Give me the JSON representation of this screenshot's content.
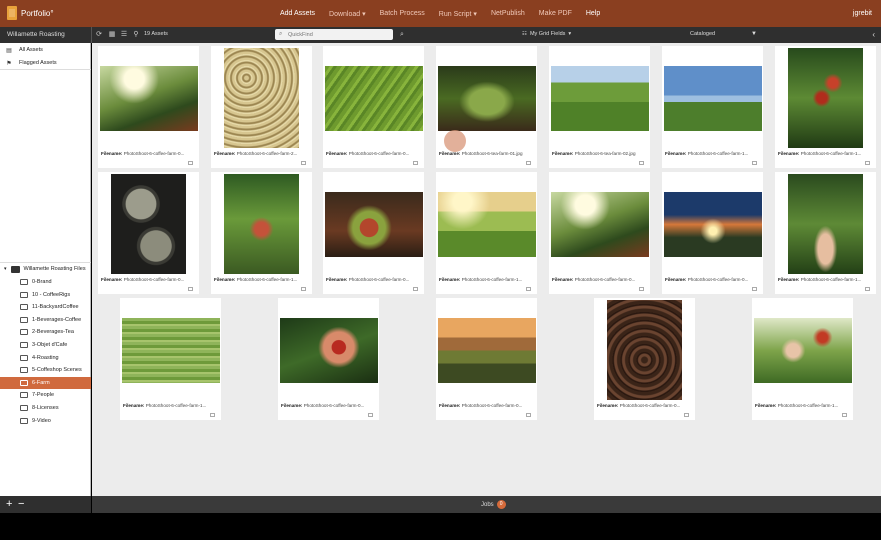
{
  "app": {
    "logo_text": "Portfolio°",
    "nav": [
      "Add Assets",
      "Download",
      "Batch Process",
      "Run Script",
      "NetPublish",
      "Make PDF",
      "Help"
    ],
    "nav_dropdowns": [
      false,
      true,
      false,
      true,
      false,
      false,
      false
    ],
    "user": "jgrebit"
  },
  "toolbar": {
    "library_title": "Willamette Roasting",
    "asset_count": "19 Assets",
    "quickfind_placeholder": "QuickFind",
    "grid_fields": "My Grid Fields",
    "catalog_status": "Cataloged"
  },
  "sidebar": {
    "top_items": [
      {
        "label": "All Assets",
        "icon": "stack-icon"
      },
      {
        "label": "Flagged Assets",
        "icon": "flag-icon"
      }
    ],
    "tree_root": "Willamette Roasting Files",
    "folders": [
      "0-Brand",
      "10 - CoffeeRigs",
      "11-BackyardCoffee",
      "1-Beverages-Coffee",
      "2-Beverages-Tea",
      "3-Objet d'Cafe",
      "4-Roasting",
      "5-Coffeshop Scenes",
      "6-Farm",
      "7-People",
      "8-Licenses",
      "9-Video"
    ],
    "selected_folder": "6-Farm"
  },
  "footer": {
    "jobs_label": "Jobs",
    "jobs_count": "0"
  },
  "grid": {
    "filename_label": "Filename:",
    "assets": [
      {
        "filename": "PhotoShoot-6-coffee-farm-0...",
        "img": "coffeesun",
        "orientation": "landscape"
      },
      {
        "filename": "PhotoShoot-6-coffee-farm-2...",
        "img": "beans",
        "orientation": "portrait"
      },
      {
        "filename": "PhotoShoot-6-coffee-farm-0...",
        "img": "terrace",
        "orientation": "landscape"
      },
      {
        "filename": "PhotoShoot-6-tea-farm-01.jpg",
        "img": "tealeaf",
        "orientation": "landscape"
      },
      {
        "filename": "PhotoShoot-6-tea-farm-02.jpg",
        "img": "teafield",
        "orientation": "landscape"
      },
      {
        "filename": "PhotoShoot-6-coffee-farm-1...",
        "img": "hillsky",
        "orientation": "landscape"
      },
      {
        "filename": "PhotoShoot-6-coffee-farm-1...",
        "img": "cherries",
        "orientation": "portrait"
      },
      {
        "filename": "PhotoShoot-6-coffee-farm-0...",
        "img": "darkbeans",
        "orientation": "portrait"
      },
      {
        "filename": "PhotoShoot-6-coffee-farm-1...",
        "img": "handcherries",
        "orientation": "portrait"
      },
      {
        "filename": "PhotoShoot-6-coffee-farm-0...",
        "img": "handful",
        "orientation": "landscape"
      },
      {
        "filename": "PhotoShoot-6-coffee-farm-1...",
        "img": "sunrows",
        "orientation": "landscape"
      },
      {
        "filename": "PhotoShoot-6-coffee-farm-0...",
        "img": "coffeesun",
        "orientation": "landscape"
      },
      {
        "filename": "PhotoShoot-6-coffee-farm-0...",
        "img": "sunset",
        "orientation": "landscape"
      },
      {
        "filename": "PhotoShoot-6-coffee-farm-1...",
        "img": "leafhand",
        "orientation": "portrait"
      },
      {
        "filename": "PhotoShoot-6-coffee-farm-1...",
        "img": "greenfield",
        "orientation": "landscape"
      },
      {
        "filename": "PhotoShoot-6-coffee-farm-0...",
        "img": "redhand",
        "orientation": "landscape"
      },
      {
        "filename": "PhotoShoot-6-coffee-farm-0...",
        "img": "mtnsunset",
        "orientation": "landscape"
      },
      {
        "filename": "PhotoShoot-6-coffee-farm-0...",
        "img": "pour",
        "orientation": "portrait"
      },
      {
        "filename": "PhotoShoot-6-coffee-farm-1...",
        "img": "pick",
        "orientation": "landscape"
      }
    ]
  },
  "colors": {
    "topbar": "#8a3f20",
    "selected_folder": "#d06a3e",
    "jobs_badge": "#d56a3a"
  }
}
